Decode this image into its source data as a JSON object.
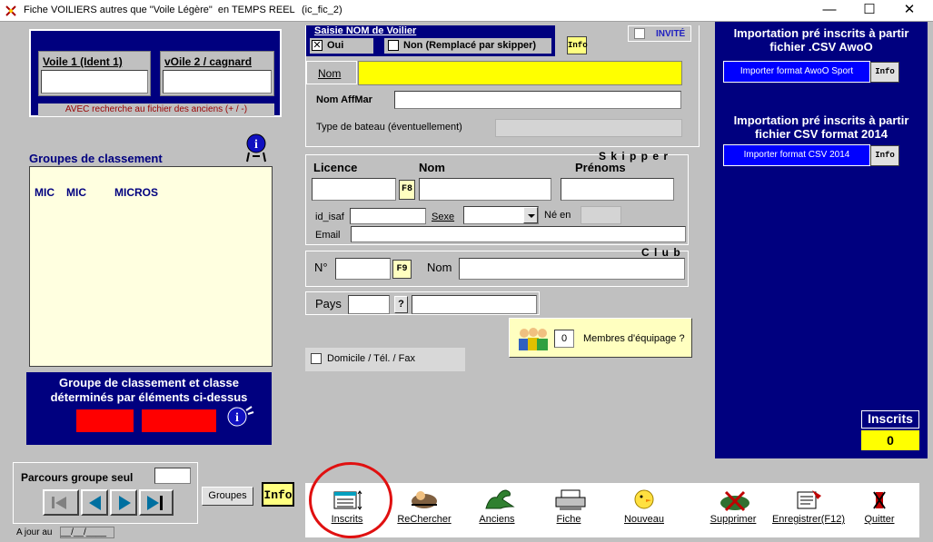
{
  "window": {
    "title": "Fiche VOILIERS autres que \"Voile Légère\"  en TEMPS REEL",
    "form_id": "(ic_fic_2)",
    "minimize": "—",
    "maximize": "☐",
    "close": "✕"
  },
  "voile": {
    "voile1_label": "Voile 1 (Ident 1)",
    "voile2_label": "vOile 2 / cagnard",
    "search_hint": "AVEC recherche au fichier des anciens (+ / -)"
  },
  "saisie": {
    "title": "Saisie NOM de Voilier",
    "oui_label": "Oui",
    "non_label": "Non (Remplacé par skipper)",
    "invite_label": "INVITÉ",
    "nom_label": "Nom",
    "nom_affmar_label": "Nom AffMar",
    "type_bateau_label": "Type de bateau (éventuellement)"
  },
  "groupes": {
    "title": "Groupes de classement",
    "items": [
      "MIC",
      "MIC",
      "MICROS"
    ]
  },
  "classe_box": {
    "text": "Groupe de classement  et classe déterminés par éléments ci-dessus"
  },
  "skipper": {
    "title": "S k i p p e r",
    "licence_label": "Licence",
    "f8_label": "F8",
    "nom_label": "Nom",
    "prenoms_label": "Prénoms",
    "id_isaf_label": "id_isaf",
    "sexe_label": "Sexe",
    "ne_en_label": "Né en",
    "email_label": "Email"
  },
  "club": {
    "title": "C l u b",
    "num_label": "N°",
    "f9_label": "F9",
    "nom_label": "Nom"
  },
  "pays": {
    "label": "Pays",
    "help": "?"
  },
  "equipage": {
    "count": "0",
    "label": "Membres d'équipage  ?"
  },
  "domicile": {
    "label": "Domicile / Tél. / Fax"
  },
  "import": {
    "awoo_title": "Importation pré inscrits à partir fichier .CSV AwoO",
    "awoo_button": "Importer format AwoO Sport",
    "csv_title": "Importation pré inscrits à partir fichier CSV format 2014",
    "csv_button": "Importer format CSV 2014"
  },
  "inscrits": {
    "label": "Inscrits",
    "count": "0"
  },
  "parcours": {
    "label": "Parcours groupe seul",
    "a_jour_label": "A jour au",
    "a_jour_value": "__/__/____",
    "groupes_button": "Groupes",
    "info": "Info"
  },
  "info_label": "Info",
  "toolbar": {
    "items": [
      "Inscrits",
      "ReChercher",
      "Anciens",
      "Fiche",
      "Nouveau",
      "Supprimer",
      "Enregistrer(F12)",
      "Quitter"
    ]
  },
  "colors": {
    "form_bg": "#c0c0c0",
    "panel_blue": "#00007f",
    "highlight_yellow": "#ffff00",
    "alert_red": "#ff0000",
    "annotation_red": "#e01010"
  }
}
